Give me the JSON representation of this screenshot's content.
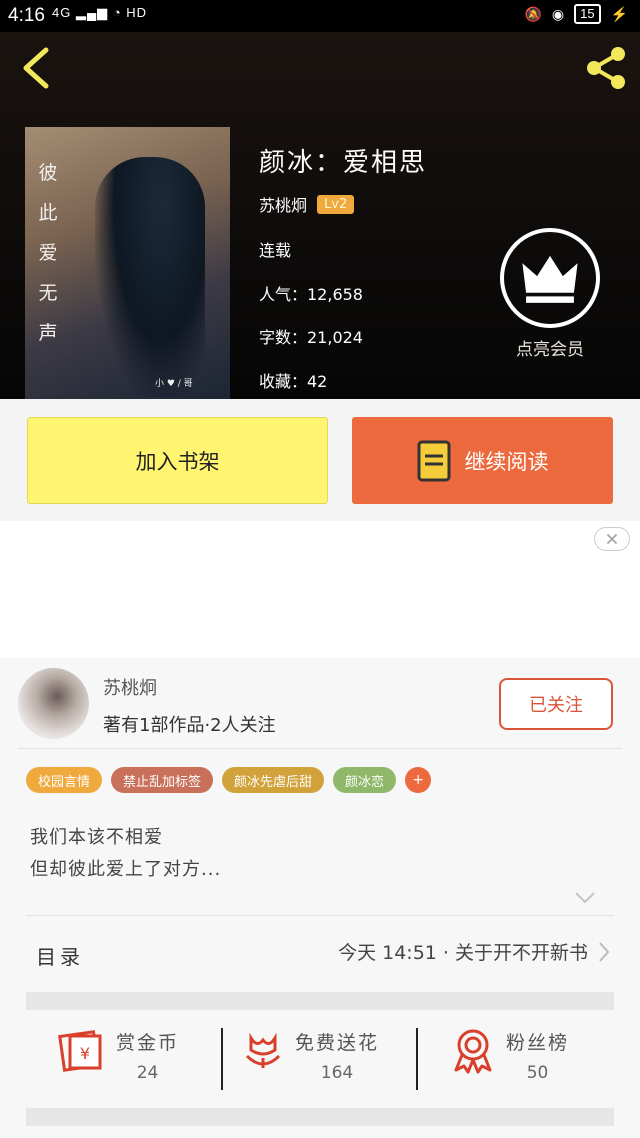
{
  "status_bar": {
    "time": "4:16",
    "signal": "4G",
    "network": "HD",
    "battery": "15"
  },
  "book": {
    "title": "颜冰：爱相思",
    "cover_text": [
      "彼",
      "此",
      "爱",
      "无",
      "声"
    ],
    "cover_small": "小 ♥ / 哥",
    "author": "苏桃炯",
    "level": "Lv2",
    "status": "连载",
    "popularity_label": "人气：12,658",
    "word_count_label": "字数：21,024",
    "favorites_label": "收藏：42"
  },
  "vip": {
    "label": "点亮会员"
  },
  "actions": {
    "add_shelf": "加入书架",
    "continue_read": "继续阅读"
  },
  "author_card": {
    "name": "苏桃炯",
    "stats": "著有1部作品·2人关注",
    "follow_label": "已关注"
  },
  "tags": [
    {
      "label": "校园言情",
      "color": "#f0a93c"
    },
    {
      "label": "禁止乱加标签",
      "color": "#c9705a"
    },
    {
      "label": "颜冰先虐后甜",
      "color": "#d1a23a"
    },
    {
      "label": "颜冰恋",
      "color": "#8fb86a"
    }
  ],
  "tag_more": "+",
  "description": {
    "line1": "我们本该不相爱",
    "line2": "但却彼此爱上了对方..."
  },
  "toc": {
    "label": "目录",
    "latest": "今天 14:51 · 关于开不开新书"
  },
  "stats": {
    "coins": {
      "label": "赏金币",
      "value": "24"
    },
    "flowers": {
      "label": "免费送花",
      "value": "164"
    },
    "fans": {
      "label": "粉丝榜",
      "value": "50"
    }
  },
  "colors": {
    "accent": "#ec6a3e",
    "shelf_button": "#fff570",
    "follow": "#d9543a",
    "level_badge": "#f0a93c"
  }
}
